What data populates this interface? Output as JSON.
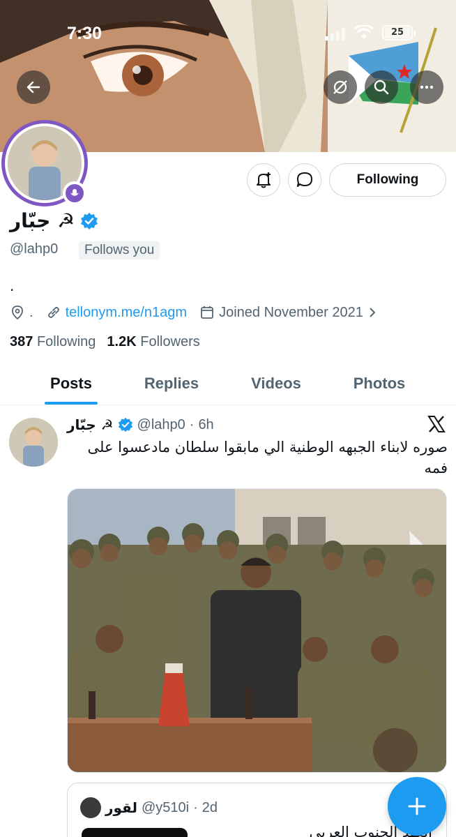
{
  "status_bar": {
    "time": "7:30",
    "battery": "25"
  },
  "profile": {
    "display_name": "جبّار ☭",
    "handle": "@lahp0",
    "follows_you": "Follows you",
    "bio": ".",
    "location": ".",
    "website": "tellonym.me/n1agm",
    "joined": "Joined November 2021",
    "following_count": "387",
    "following_label": "Following",
    "followers_count": "1.2K",
    "followers_label": "Followers"
  },
  "actions": {
    "following_button": "Following"
  },
  "tabs": [
    {
      "label": "Posts"
    },
    {
      "label": "Replies"
    },
    {
      "label": "Videos"
    },
    {
      "label": "Photos"
    }
  ],
  "post": {
    "author_name": "جبّار ☭",
    "author_handle": "@lahp0",
    "time": "6h",
    "text": "صوره لابناء الجبهه الوطنية الي مابقوا سلطان مادعسوا على فمه"
  },
  "quote": {
    "author_name": "لقور",
    "author_handle": "@y510i",
    "time": "2d",
    "text": "العهد الجنوب العربي"
  },
  "colors": {
    "accent": "#1d9bf0",
    "ring": "#7e57c2",
    "text": "#0f1419",
    "muted": "#536471"
  }
}
